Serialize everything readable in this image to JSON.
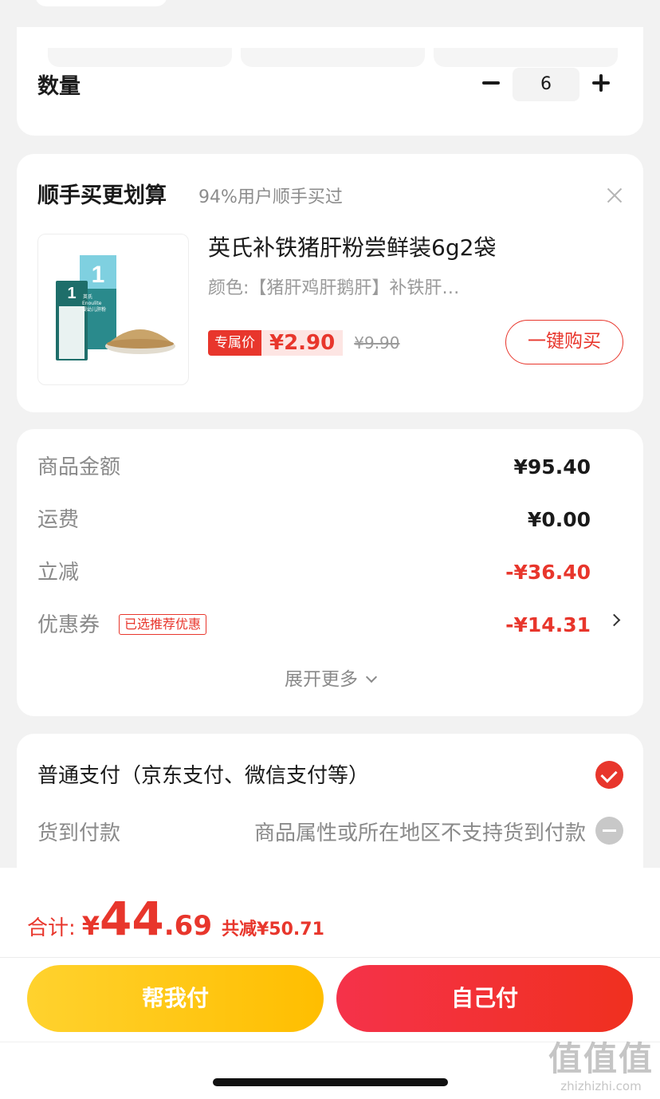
{
  "quantity": {
    "label": "数量",
    "value": "6"
  },
  "upsell": {
    "title": "顺手买更划算",
    "subtitle": "94%用户顺手买过",
    "product": {
      "name": "英氏补铁猪肝粉尝鲜装6g2袋",
      "spec": "颜色:【猪肝鸡肝鹅肝】补铁肝…",
      "price_tag": "专属价",
      "price": "¥2.90",
      "original_price": "¥9.90",
      "image_text_brand": "英氏",
      "image_text_en": "Enoulite",
      "image_text_cn": "婴幼儿肝粉"
    },
    "buy_button": "一键购买"
  },
  "summary": {
    "rows": [
      {
        "label": "商品金额",
        "value": "¥95.40"
      },
      {
        "label": "运费",
        "value": "¥0.00"
      },
      {
        "label": "立减",
        "value": "-¥36.40"
      },
      {
        "label": "优惠券",
        "value": "-¥14.31",
        "badge": "已选推荐优惠"
      }
    ],
    "expand_label": "展开更多"
  },
  "payment": {
    "normal_label": "普通支付（京东支付、微信支付等）",
    "cod_label": "货到付款",
    "cod_note": "商品属性或所在地区不支持货到付款"
  },
  "total": {
    "label": "合计:",
    "symbol": "¥",
    "integer": "44",
    "decimal": ".69",
    "saved": "共减¥50.71"
  },
  "buttons": {
    "help_pay": "帮我付",
    "self_pay": "自己付"
  },
  "watermark": {
    "logo": "值值值",
    "url": "zhizhizhi.com"
  },
  "colors": {
    "accent": "#e8362c",
    "yellow": "#ffc20e",
    "background": "#f2f2f2"
  }
}
